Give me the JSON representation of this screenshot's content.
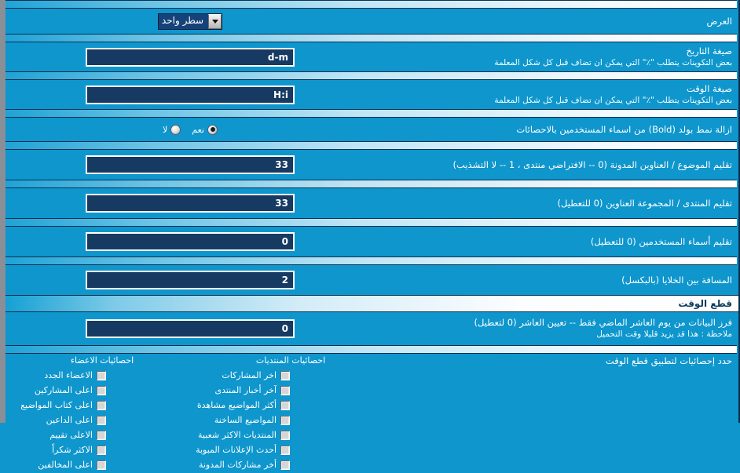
{
  "display_row": {
    "label": "العرض",
    "select_value": "سطر واحد",
    "arrow_icon": "chevron-down-icon"
  },
  "rows": [
    {
      "title": "صيغة التاريخ",
      "sub": "بعض التكوينات يتطلب \"٪\" التي يمكن ان تضاف قبل كل شكل المعلمة",
      "value": "d-m"
    },
    {
      "title": "صيغة الوقت",
      "sub": "بعض التكوينات يتطلب \"٪\" التي يمكن ان تضاف قبل كل شكل المعلمة",
      "value": "H:i"
    },
    {
      "title": "ازالة نمط بولد (Bold) من اسماء المستخدمين بالاحصائات",
      "sub": "",
      "radio": {
        "yes_label": "نعم",
        "no_label": "لا",
        "selected": "yes"
      }
    },
    {
      "title": "تقليم الموضوع / العناوين المدونة (0 -- الافتراضي منتدى ، 1 -- لا التشذيب)",
      "sub": "",
      "value": "33"
    },
    {
      "title": "تقليم المنتدى / المجموعة العناوين (0 للتعطيل)",
      "sub": "",
      "value": "33"
    },
    {
      "title": "تقليم أسماء المستخدمين (0 للتعطيل)",
      "sub": "",
      "value": "0"
    },
    {
      "title": "المسافة بين الخلايا (بالبكسل)",
      "sub": "",
      "value": "2"
    }
  ],
  "time_section": {
    "header": "قطع الوقت",
    "row": {
      "title": "فرز البيانات من يوم العاشر الماضي فقط -- تعيين العاشر (0 لتعطيل)",
      "sub": "ملاحظة : هذا قد يزيد قليلا وقت التحميل",
      "value": "0"
    }
  },
  "stats_section": {
    "label": "حدد إحصائيات لتطبيق قطع الوقت",
    "columns": [
      {
        "head": "احصائيات المنتديات",
        "items": [
          {
            "label": "اخر المشاركات",
            "checked": false
          },
          {
            "label": "آخر أخبار المنتدى",
            "checked": false
          },
          {
            "label": "أكثر المواضيع مشاهدة",
            "checked": false
          },
          {
            "label": "المواضيع الساخنة",
            "checked": false
          },
          {
            "label": "المنتديات الاكثر شعبية",
            "checked": false
          },
          {
            "label": "أحدث الإعلانات المبوبة",
            "checked": false
          },
          {
            "label": "أخر مشاركات المدونة",
            "checked": false
          }
        ]
      },
      {
        "head": "احصائيات الاعضاء",
        "items": [
          {
            "label": "الاعضاء الجدد",
            "checked": false
          },
          {
            "label": "اعلى المشاركين",
            "checked": false
          },
          {
            "label": "اعلى كتاب المواضيع",
            "checked": false
          },
          {
            "label": "اعلى الداعين",
            "checked": false
          },
          {
            "label": "الاعلى تقييم",
            "checked": false
          },
          {
            "label": "الاكثر شكراً",
            "checked": false
          },
          {
            "label": "اعلى المخالفين",
            "checked": false
          }
        ]
      }
    ]
  },
  "colors": {
    "page_bg": "#0e96cd",
    "input_bg": "#163a62",
    "border_dark": "#0b2f4e",
    "text": "#ffffff",
    "header_text": "#0c3b5e"
  }
}
